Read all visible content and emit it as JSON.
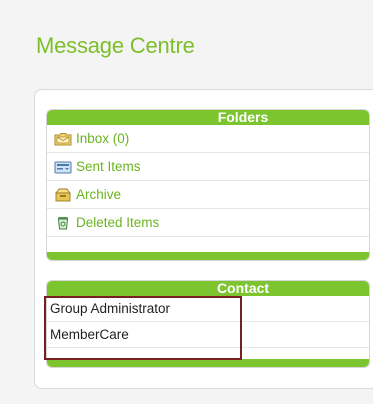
{
  "page": {
    "title": "Message Centre"
  },
  "folders": {
    "header": "Folders",
    "items": [
      {
        "label": "Inbox (0)",
        "icon": "inbox-icon"
      },
      {
        "label": "Sent Items",
        "icon": "sent-items-icon"
      },
      {
        "label": "Archive",
        "icon": "archive-icon"
      },
      {
        "label": "Deleted Items",
        "icon": "trash-icon"
      }
    ]
  },
  "contact": {
    "header": "Contact",
    "items": [
      {
        "label": "Group Administrator"
      },
      {
        "label": "MemberCare"
      }
    ]
  },
  "colors": {
    "accent_green": "#7cc52e",
    "link_green": "#6ab421",
    "highlight_border": "#7a1f1f"
  }
}
